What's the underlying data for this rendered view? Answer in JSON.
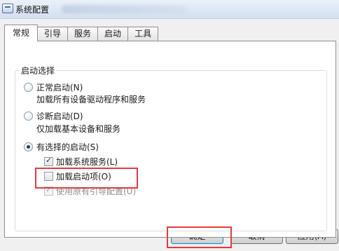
{
  "window": {
    "title": "系统配置"
  },
  "tabs": [
    {
      "label": "常规"
    },
    {
      "label": "引导"
    },
    {
      "label": "服务"
    },
    {
      "label": "启动"
    },
    {
      "label": "工具"
    }
  ],
  "startup_group": {
    "legend": "启动选择",
    "options": [
      {
        "label": "正常启动(N)",
        "description": "加载所有设备驱动程序和服务",
        "selected": false
      },
      {
        "label": "诊断启动(D)",
        "description": "仅加载基本设备和服务",
        "selected": false
      },
      {
        "label": "有选择的启动(S)",
        "selected": true
      }
    ],
    "selective_items": [
      {
        "label": "加载系统服务(L)",
        "checked": true,
        "enabled": true
      },
      {
        "label": "加载启动项(O)",
        "checked": false,
        "enabled": true
      },
      {
        "label": "使用原有引导配置(U)",
        "checked": true,
        "enabled": false
      }
    ]
  },
  "buttons": {
    "ok": "确定",
    "cancel": "取消",
    "apply": "应用(A)"
  },
  "colors": {
    "highlight": "#e33b3b",
    "tab_border": "#8e8f8f"
  }
}
